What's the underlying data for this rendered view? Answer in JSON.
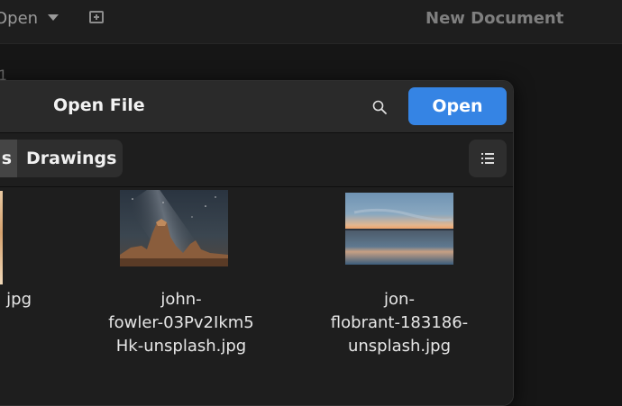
{
  "window": {
    "open_label": "Open",
    "title": "New Document",
    "line_number": "1"
  },
  "dialog": {
    "title": "Open File",
    "open_button": "Open",
    "path": {
      "previous_segment": "s",
      "current_segment": "Drawings"
    }
  },
  "files": [
    {
      "name": "jpg",
      "icon": "image-thumbnail"
    },
    {
      "name_lines": [
        "john-",
        "fowler-03Pv2Ikm5",
        "Hk-unsplash.jpg"
      ],
      "icon": "image-thumbnail"
    },
    {
      "name_lines": [
        "jon-",
        "flobrant-183186-",
        "unsplash.jpg"
      ],
      "icon": "image-thumbnail"
    }
  ],
  "colors": {
    "accent": "#3584e4",
    "dialog_bg": "#1e1e1e",
    "header_bg": "#2a2a2a"
  }
}
